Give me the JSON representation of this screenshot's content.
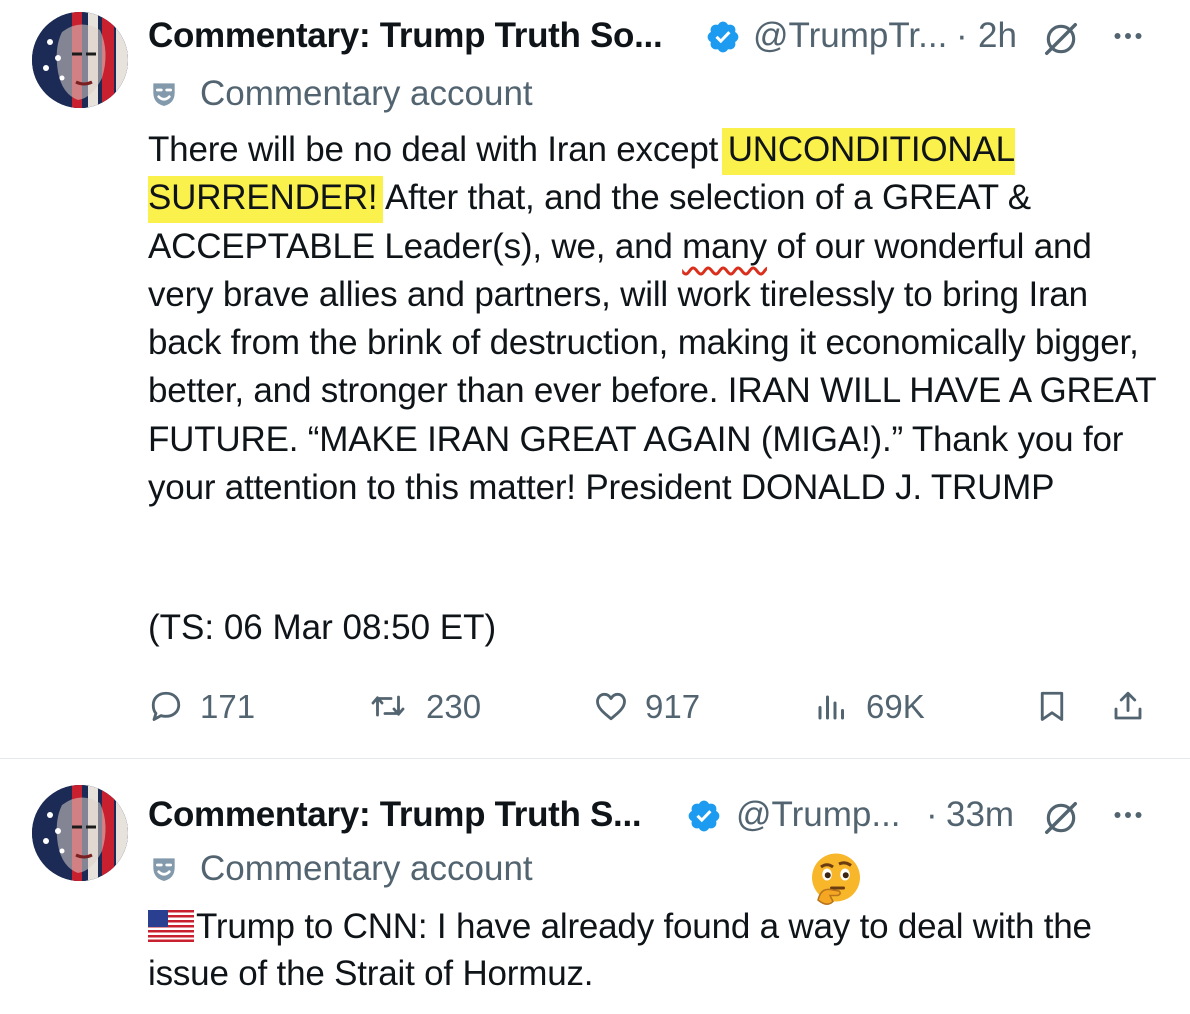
{
  "tweets": [
    {
      "author_name": "Commentary: Trump Truth So...",
      "handle": "@TrumpTr...",
      "dot": "·",
      "time": "2h",
      "commentary_label": "Commentary account",
      "text_parts": [
        "There will be no deal with Iran except ",
        "UNCONDITIONAL SURRENDER!",
        " After that, and the selection of a GREAT & ACCEPTABLE Leader(s), we, and ",
        "many",
        " of our wonderful and very brave allies and partners, will work tirelessly to bring Iran back from the brink of destruction, making it economically bigger, better, and stronger than ever before. IRAN WILL HAVE A GREAT FUTURE. “MAKE IRAN GREAT AGAIN (MIGA!).” Thank you for your attention to this matter! President DONALD J. TRUMP"
      ],
      "timestamp_note": "(TS: 06 Mar 08:50 ET)",
      "actions": {
        "replies": "171",
        "reposts": "230",
        "likes": "917",
        "views": "69K"
      },
      "highlight_color": "#fbf14c"
    },
    {
      "author_name": "Commentary: Trump Truth S...",
      "handle": "@Trump...",
      "dot": "·",
      "time": "33m",
      "commentary_label": "Commentary account",
      "text": "Trump to CNN: I have already found a way to deal with the issue of the Strait of Hormuz.",
      "flag_icon": "us-flag-icon",
      "emoji_icon": "thinking-face-emoji"
    }
  ],
  "colors": {
    "text": "#0f1419",
    "secondary": "#536471",
    "verified": "#1d9bf0",
    "divider": "#e6e9eb"
  }
}
